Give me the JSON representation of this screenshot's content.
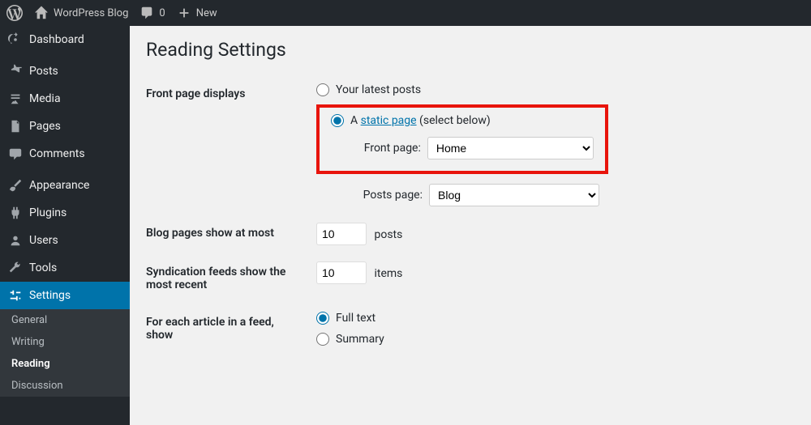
{
  "adminbar": {
    "site_title": "WordPress Blog",
    "comments": "0",
    "new_label": "New"
  },
  "sidebar": {
    "items": [
      {
        "label": "Dashboard"
      },
      {
        "label": "Posts"
      },
      {
        "label": "Media"
      },
      {
        "label": "Pages"
      },
      {
        "label": "Comments"
      },
      {
        "label": "Appearance"
      },
      {
        "label": "Plugins"
      },
      {
        "label": "Users"
      },
      {
        "label": "Tools"
      },
      {
        "label": "Settings"
      }
    ],
    "submenu": [
      "General",
      "Writing",
      "Reading",
      "Discussion"
    ]
  },
  "page": {
    "title": "Reading Settings",
    "front_displays_label": "Front page displays",
    "radio_latest": "Your latest posts",
    "radio_static_prefix": "A ",
    "radio_static_link": "static page",
    "radio_static_suffix": " (select below)",
    "front_page_label": "Front page:",
    "front_page_value": "Home",
    "posts_page_label": "Posts page:",
    "posts_page_value": "Blog",
    "blog_pages_label": "Blog pages show at most",
    "blog_pages_value": "10",
    "blog_pages_unit": "posts",
    "syndication_label": "Syndication feeds show the most recent",
    "syndication_value": "10",
    "syndication_unit": "items",
    "feed_format_label": "For each article in a feed, show",
    "feed_full": "Full text",
    "feed_summary": "Summary"
  }
}
